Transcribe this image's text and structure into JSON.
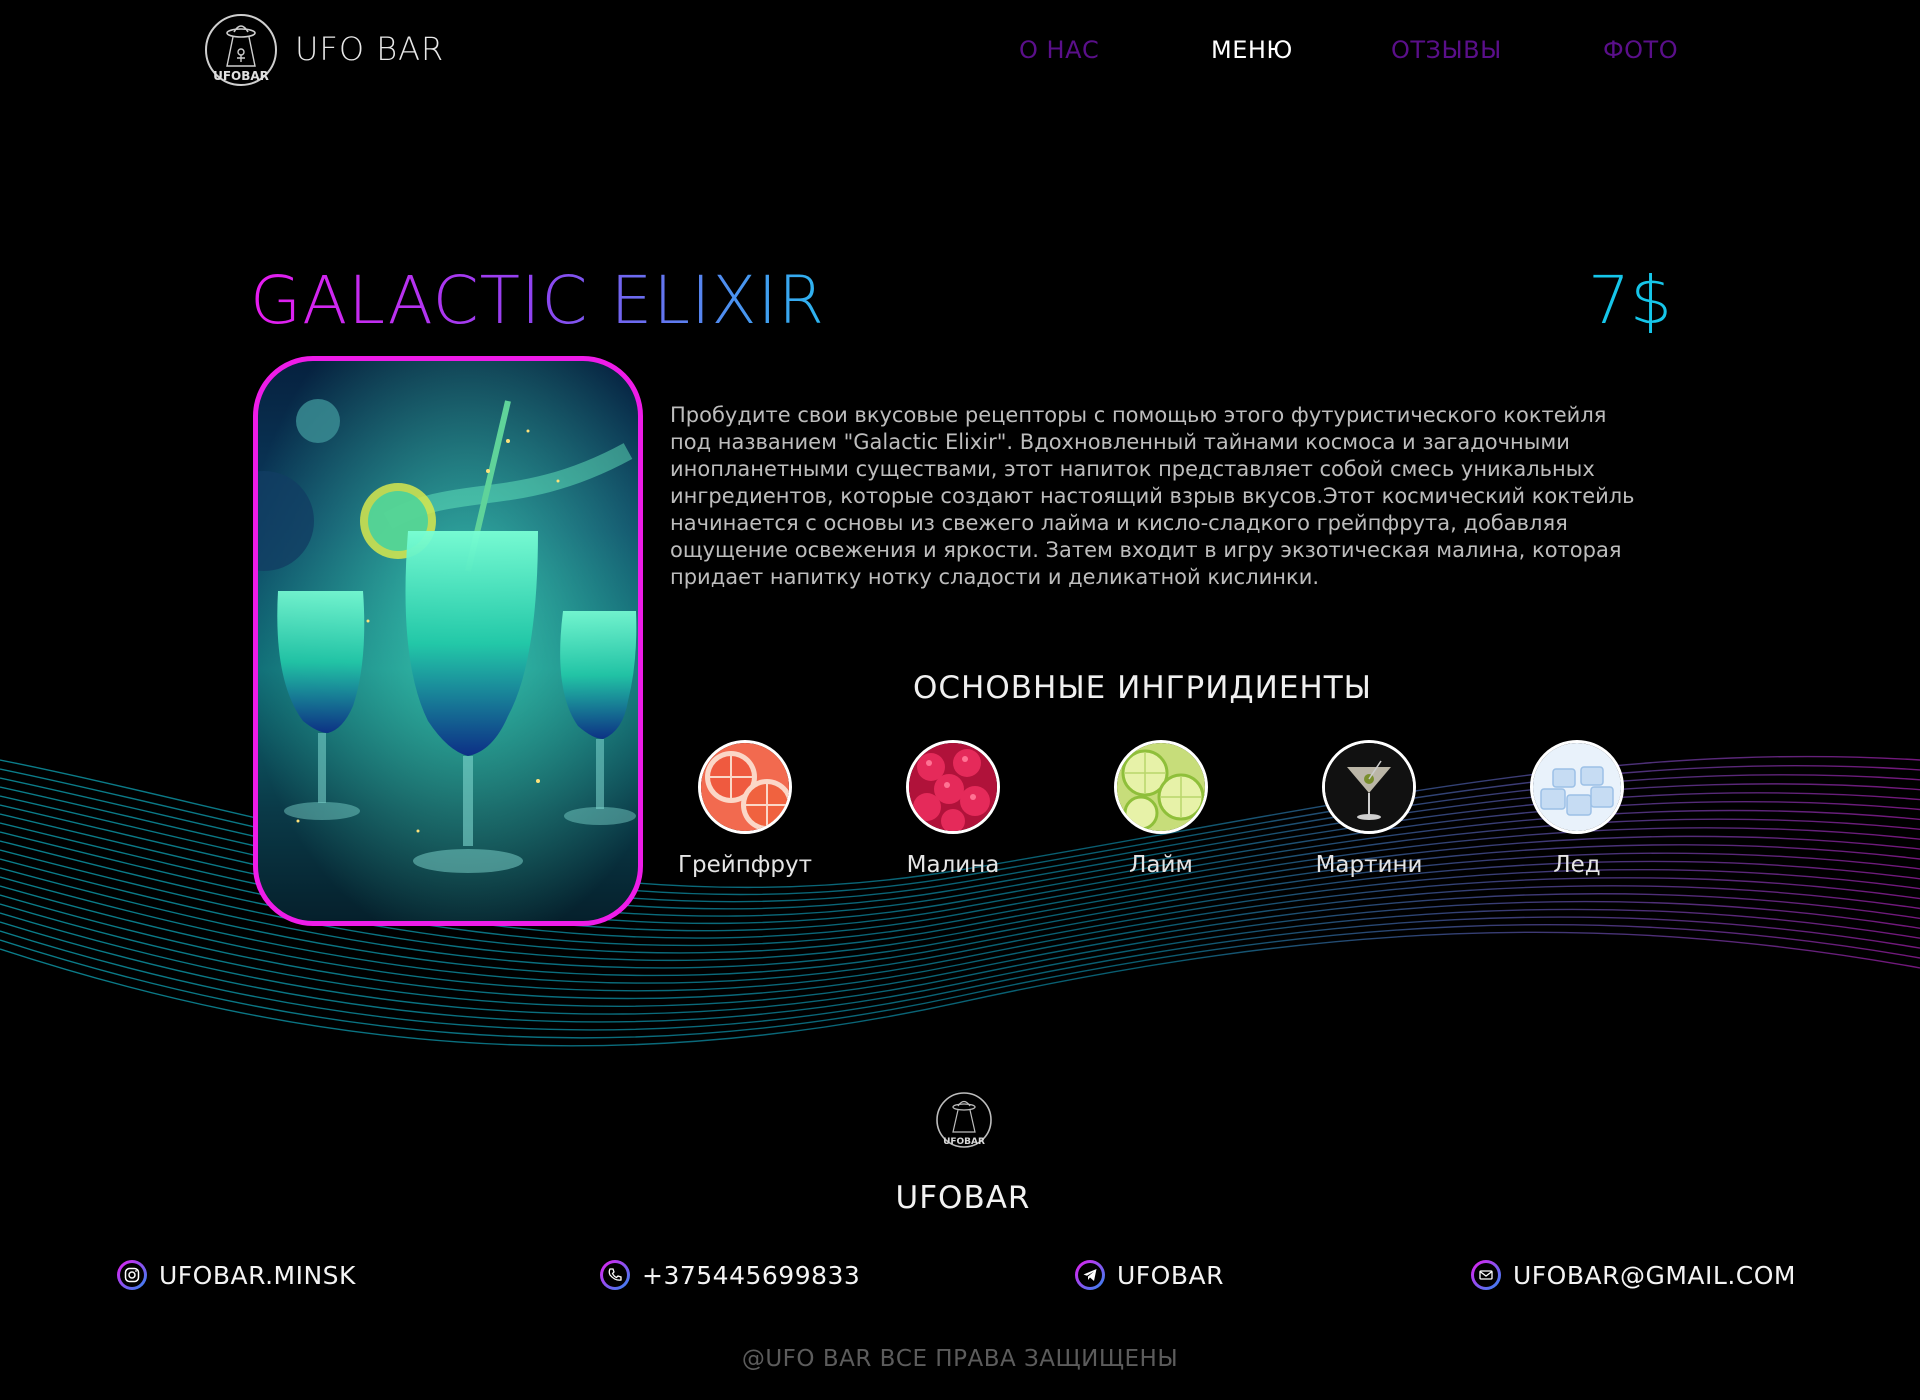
{
  "header": {
    "logo_text": "UFOBAR",
    "brand": "UFO BAR",
    "nav": [
      {
        "label": "О НАС",
        "state": "dim"
      },
      {
        "label": "МЕНЮ",
        "state": "active"
      },
      {
        "label": "ОТЗЫВЫ",
        "state": "dim"
      },
      {
        "label": "ФОТО",
        "state": "dim"
      }
    ]
  },
  "product": {
    "title": "GALACTIC ELIXIR",
    "price": "7$",
    "description": "Пробудите свои вкусовые рецепторы с помощью этого футуристического коктейля под названием \"Galactic Elixir\". Вдохновленный тайнами космоса и загадочными инопланетными существами, этот напиток представляет собой смесь уникальных ингредиентов, которые создают настоящий взрыв вкусов.Этот космический коктейль начинается с основы из свежего лайма и кисло-сладкого грейпфрута, добавляя ощущение освежения и яркости. Затем входит в игру экзотическая малина, которая придает напитку нотку сладости и деликатной кислинки."
  },
  "ingredients": {
    "title": "ОСНОВНЫЕ ИНГРИДИЕНТЫ",
    "items": [
      {
        "label": "Грейпфрут",
        "icon": "grapefruit"
      },
      {
        "label": "Малина",
        "icon": "raspberry"
      },
      {
        "label": "Лайм",
        "icon": "lime"
      },
      {
        "label": "Мартини",
        "icon": "martini"
      },
      {
        "label": "Лед",
        "icon": "ice"
      }
    ]
  },
  "footer": {
    "logo_text": "UFOBAR",
    "name": "UFOBAR",
    "contacts": [
      {
        "icon": "instagram-icon",
        "text": "UFOBAR.MINSK"
      },
      {
        "icon": "phone-icon",
        "text": "+375445699833"
      },
      {
        "icon": "telegram-icon",
        "text": "UFOBAR"
      },
      {
        "icon": "mail-icon",
        "text": "UFOBAR@GMAIL.COM"
      }
    ],
    "copyright": "@UFO BAR ВСЕ ПРАВА ЗАЩИЩЕНЫ"
  },
  "colors": {
    "accent_pink": "#ee1ce8",
    "accent_cyan": "#16c6ea",
    "nav_dim": "#5a0f8a"
  }
}
